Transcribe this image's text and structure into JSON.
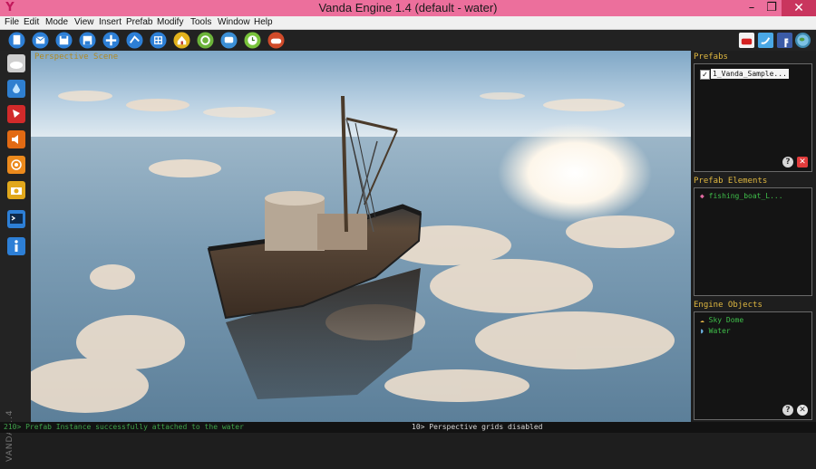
{
  "window": {
    "title": "Vanda Engine 1.4 (default - water)",
    "minimize_glyph": "–",
    "maximize_glyph": "❐",
    "close_glyph": "✕",
    "logo_glyph": "Y"
  },
  "menu": {
    "items": [
      "File",
      "Edit",
      "Mode",
      "View",
      "Insert",
      "Prefab",
      "Modify",
      "Tools",
      "Window",
      "Help"
    ]
  },
  "toolbar": {
    "buttons": [
      "new-icon",
      "open-icon",
      "save-icon",
      "save-as-icon",
      "move-icon",
      "export-icon",
      "grid-icon",
      "home-icon",
      "refresh-icon",
      "chat-icon",
      "clock-icon",
      "gamepad-icon"
    ],
    "social": [
      "youtube-icon",
      "twitter-icon",
      "facebook-icon",
      "globe-icon"
    ]
  },
  "leftbar": {
    "buttons": [
      "sky-icon",
      "water-icon",
      "light-icon",
      "sound-icon",
      "ambient-sound-icon",
      "camera-icon",
      "console-icon",
      "info-icon"
    ]
  },
  "version_label": "VANDA 1.4",
  "viewport": {
    "label": "Perspective Scene"
  },
  "prefabs": {
    "title": "Prefabs",
    "items": [
      {
        "label": "1_Vanda_Sample...",
        "checked": true
      }
    ]
  },
  "prefab_elements": {
    "title": "Prefab Elements",
    "items": [
      "fishing_boat_L..."
    ]
  },
  "engine_objects": {
    "title": "Engine Objects",
    "items": [
      "Sky Dome",
      "Water"
    ]
  },
  "status": {
    "left": "210> Prefab Instance successfully attached to the water",
    "center": "10> Perspective grids disabled"
  },
  "colors": {
    "title_bar": "#ec6f9c",
    "panel_title": "#e0b840",
    "list_text": "#3fbf4a",
    "status_text": "#3fa34a"
  }
}
